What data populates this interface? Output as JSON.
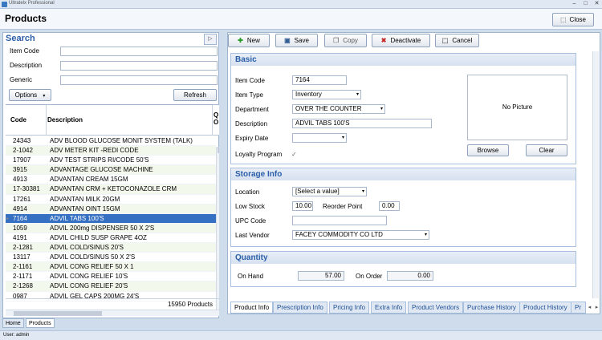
{
  "window": {
    "title": "Ultratelx Professional",
    "minimize": "–",
    "maximize": "□",
    "close": "✕"
  },
  "page": {
    "title": "Products",
    "close_label": "Close"
  },
  "search": {
    "title": "Search",
    "item_code_label": "Item Code",
    "description_label": "Description",
    "generic_label": "Generic",
    "item_code_value": "",
    "description_value": "",
    "generic_value": "",
    "options_label": "Options",
    "refresh_label": "Refresh"
  },
  "grid": {
    "columns": {
      "code": "Code",
      "description": "Description",
      "q": "Q O"
    },
    "rows": [
      {
        "code": "24343",
        "description": "ADV BLOOD GLUCOSE MONIT SYSTEM (TALK)"
      },
      {
        "code": "2-1042",
        "description": "ADV METER KIT -REDI CODE"
      },
      {
        "code": "17907",
        "description": "ADV TEST STRIPS  RI/CODE 50'S"
      },
      {
        "code": "3915",
        "description": "ADVANTAGE GLUCOSE MACHINE"
      },
      {
        "code": "4913",
        "description": "ADVANTAN CREAM 15GM"
      },
      {
        "code": "17-30381",
        "description": "ADVANTAN CRM + KETOCONAZOLE CRM"
      },
      {
        "code": "17261",
        "description": "ADVANTAN MILK 20GM"
      },
      {
        "code": "4914",
        "description": "ADVANTAN OINT 15GM"
      },
      {
        "code": "7164",
        "description": "ADVIL  TABS  100'S",
        "selected": true
      },
      {
        "code": "1059",
        "description": "ADVIL 200mg DISPENSER 50 X 2'S"
      },
      {
        "code": "4191",
        "description": "ADVIL CHILD SUSP GRAPE 4OZ"
      },
      {
        "code": "2-1281",
        "description": "ADVIL COLD/SINUS 20'S"
      },
      {
        "code": "13117",
        "description": "ADVIL COLD/SINUS 50 X  2'S"
      },
      {
        "code": "2-1161",
        "description": "ADVIL CONG RELIEF  50 X 1"
      },
      {
        "code": "2-1171",
        "description": "ADVIL CONG RELIEF 10'S"
      },
      {
        "code": "2-1268",
        "description": "ADVIL CONG RELIEF 20'S"
      },
      {
        "code": "0987",
        "description": "ADVIL GEL CAPS 200MG 24'S"
      }
    ],
    "count": "15950 Products"
  },
  "bottom_tabs": [
    "Home",
    "Products"
  ],
  "status": {
    "user": "User: admin"
  },
  "toolbar": {
    "new": "New",
    "save": "Save",
    "copy": "Copy",
    "deactivate": "Deactivate",
    "cancel": "Cancel"
  },
  "basic": {
    "title": "Basic",
    "item_code_label": "Item Code",
    "item_code": "7164",
    "item_type_label": "Item Type",
    "item_type": "Inventory",
    "department_label": "Department",
    "department": "OVER THE COUNTER",
    "description_label": "Description",
    "description": "ADVIL  TABS  100'S",
    "expiry_label": "Expiry Date",
    "expiry": "",
    "loyalty_label": "Loyalty Program",
    "loyalty_checked": true,
    "no_picture": "No Picture",
    "browse": "Browse",
    "clear": "Clear"
  },
  "storage": {
    "title": "Storage Info",
    "location_label": "Location",
    "location": "[Select a value]",
    "low_stock_label": "Low Stock",
    "low_stock": "10.00",
    "reorder_label": "Reorder Point",
    "reorder": "0.00",
    "upc_label": "UPC Code",
    "upc": "",
    "vendor_label": "Last Vendor",
    "vendor": "FACEY COMMODITY CO LTD"
  },
  "quantity": {
    "title": "Quantity",
    "on_hand_label": "On Hand",
    "on_hand": "57.00",
    "on_order_label": "On Order",
    "on_order": "0.00"
  },
  "product_tabs": [
    "Product Info",
    "Prescription Info",
    "Pricing Info",
    "Extra Info",
    "Product Vendors",
    "Purchase History",
    "Product History",
    "Pr"
  ]
}
